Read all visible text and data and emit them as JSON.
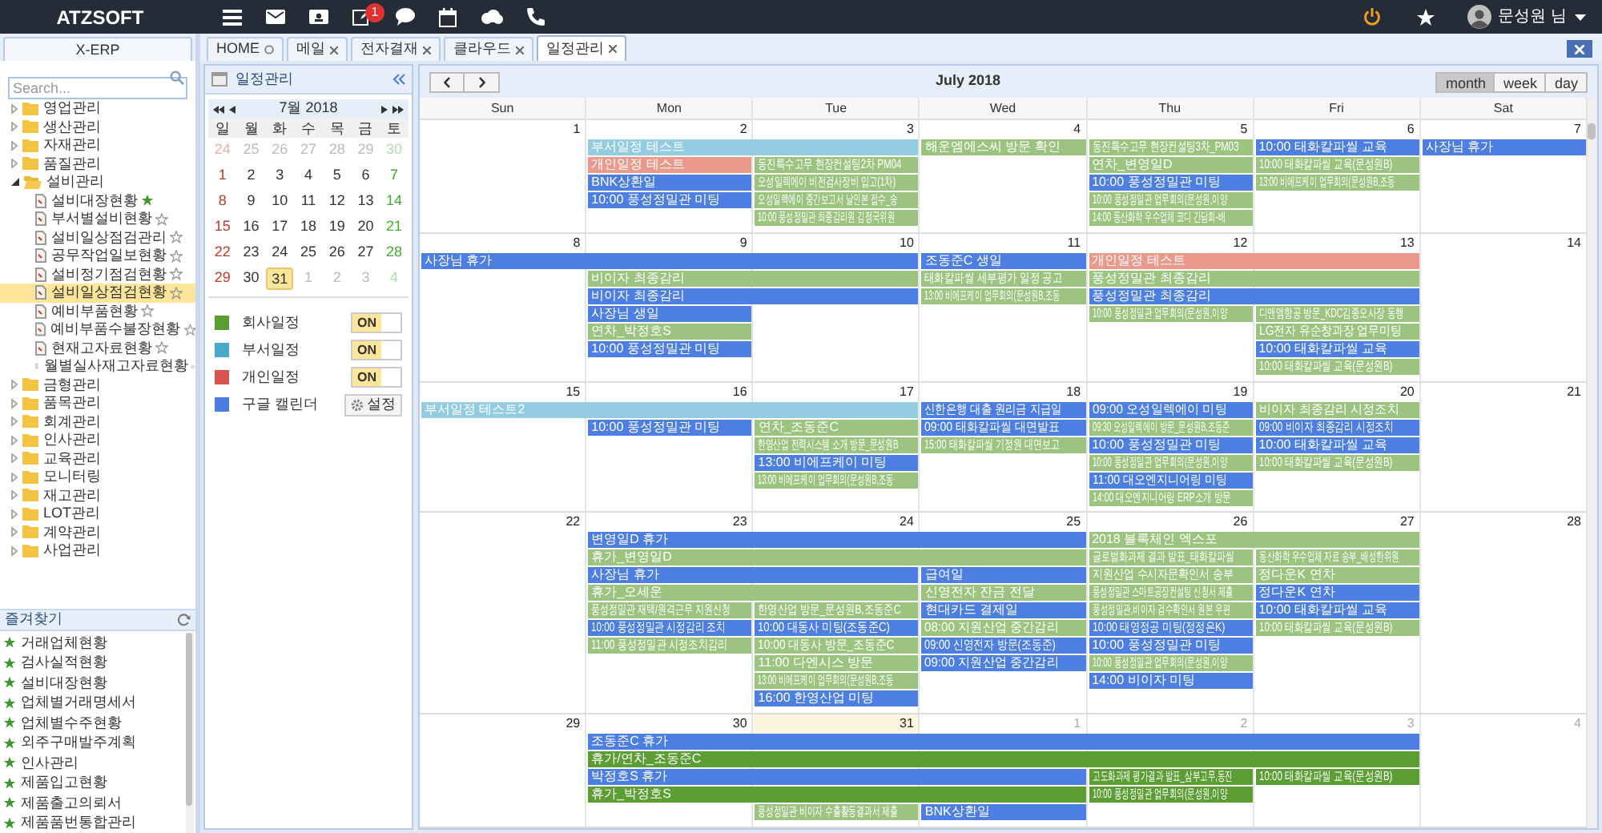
{
  "topbar": {
    "logo": "ATZSOFT",
    "badge": "1",
    "user": "문성원 님"
  },
  "sidebar": {
    "tab": "X-ERP",
    "search": {
      "placeholder": "Search..."
    },
    "tree": [
      {
        "label": "영업관리",
        "kind": "folder",
        "expanded": false,
        "selected": false
      },
      {
        "label": "생산관리",
        "kind": "folder",
        "expanded": false,
        "selected": false
      },
      {
        "label": "자재관리",
        "kind": "folder",
        "expanded": false,
        "selected": false
      },
      {
        "label": "품질관리",
        "kind": "folder",
        "expanded": false,
        "selected": false
      },
      {
        "label": "설비관리",
        "kind": "folder",
        "expanded": true,
        "selected": false,
        "children": [
          {
            "label": "설비대장현황",
            "kind": "page",
            "starred": true,
            "selected": false
          },
          {
            "label": "부서별설비현황",
            "kind": "page",
            "starred": false,
            "selected": false
          },
          {
            "label": "설비일상점검관리",
            "kind": "page",
            "starred": false,
            "selected": false
          },
          {
            "label": "공무작업일보현황",
            "kind": "page",
            "starred": false,
            "selected": false
          },
          {
            "label": "설비정기점검현황",
            "kind": "page",
            "starred": false,
            "selected": false
          },
          {
            "label": "설비일상점검현황",
            "kind": "page",
            "starred": false,
            "selected": true
          },
          {
            "label": "예비부품현황",
            "kind": "page",
            "starred": false,
            "selected": false
          },
          {
            "label": "예비부품수불장현황",
            "kind": "page",
            "starred": false,
            "selected": false
          },
          {
            "label": "현재고자료현황",
            "kind": "page",
            "starred": false,
            "selected": false
          },
          {
            "label": "월별실사재고자료현황",
            "kind": "page",
            "starred": false,
            "selected": false
          }
        ]
      },
      {
        "label": "금형관리",
        "kind": "folder",
        "expanded": false,
        "selected": false
      },
      {
        "label": "품목관리",
        "kind": "folder",
        "expanded": false,
        "selected": false
      },
      {
        "label": "회계관리",
        "kind": "folder",
        "expanded": false,
        "selected": false
      },
      {
        "label": "인사관리",
        "kind": "folder",
        "expanded": false,
        "selected": false
      },
      {
        "label": "교육관리",
        "kind": "folder",
        "expanded": false,
        "selected": false
      },
      {
        "label": "모니터링",
        "kind": "folder",
        "expanded": false,
        "selected": false
      },
      {
        "label": "재고관리",
        "kind": "folder",
        "expanded": false,
        "selected": false
      },
      {
        "label": "LOT관리",
        "kind": "folder",
        "expanded": false,
        "selected": false
      },
      {
        "label": "계약관리",
        "kind": "folder",
        "expanded": false,
        "selected": false
      },
      {
        "label": "사업관리",
        "kind": "folder",
        "expanded": false,
        "selected": false
      }
    ],
    "favorites_title": "즐겨찾기",
    "favorites": [
      "거래업체현황",
      "검사실적현황",
      "설비대장현황",
      "업체별거래명세서",
      "업체별수주현황",
      "외주구매발주계획",
      "인사관리",
      "제품입고현황",
      "제품출고의뢰서",
      "제품품번통합관리"
    ]
  },
  "tabs": [
    {
      "label": "HOME",
      "kind": "home",
      "selected": false
    },
    {
      "label": "메일",
      "kind": "closable",
      "selected": false
    },
    {
      "label": "전자결재",
      "kind": "closable",
      "selected": false
    },
    {
      "label": "클라우드",
      "kind": "closable",
      "selected": false
    },
    {
      "label": "일정관리",
      "kind": "closable",
      "selected": true
    }
  ],
  "mini_calendar": {
    "title": "일정관리",
    "month": "7월 2018",
    "weekdays": [
      "일",
      "월",
      "화",
      "수",
      "목",
      "금",
      "토"
    ],
    "weeks": [
      [
        {
          "label": "24",
          "other_month": true,
          "selected": false
        },
        {
          "label": "25",
          "other_month": true,
          "selected": false
        },
        {
          "label": "26",
          "other_month": true,
          "selected": false
        },
        {
          "label": "27",
          "other_month": true,
          "selected": false
        },
        {
          "label": "28",
          "other_month": true,
          "selected": false
        },
        {
          "label": "29",
          "other_month": true,
          "selected": false
        },
        {
          "label": "30",
          "other_month": true,
          "selected": false
        }
      ],
      [
        {
          "label": "1",
          "other_month": false,
          "selected": false
        },
        {
          "label": "2",
          "other_month": false,
          "selected": false
        },
        {
          "label": "3",
          "other_month": false,
          "selected": false
        },
        {
          "label": "4",
          "other_month": false,
          "selected": false
        },
        {
          "label": "5",
          "other_month": false,
          "selected": false
        },
        {
          "label": "6",
          "other_month": false,
          "selected": false
        },
        {
          "label": "7",
          "other_month": false,
          "selected": false
        }
      ],
      [
        {
          "label": "8",
          "other_month": false,
          "selected": false
        },
        {
          "label": "9",
          "other_month": false,
          "selected": false
        },
        {
          "label": "10",
          "other_month": false,
          "selected": false
        },
        {
          "label": "11",
          "other_month": false,
          "selected": false
        },
        {
          "label": "12",
          "other_month": false,
          "selected": false
        },
        {
          "label": "13",
          "other_month": false,
          "selected": false
        },
        {
          "label": "14",
          "other_month": false,
          "selected": false
        }
      ],
      [
        {
          "label": "15",
          "other_month": false,
          "selected": false
        },
        {
          "label": "16",
          "other_month": false,
          "selected": false
        },
        {
          "label": "17",
          "other_month": false,
          "selected": false
        },
        {
          "label": "18",
          "other_month": false,
          "selected": false
        },
        {
          "label": "19",
          "other_month": false,
          "selected": false
        },
        {
          "label": "20",
          "other_month": false,
          "selected": false
        },
        {
          "label": "21",
          "other_month": false,
          "selected": false
        }
      ],
      [
        {
          "label": "22",
          "other_month": false,
          "selected": false
        },
        {
          "label": "23",
          "other_month": false,
          "selected": false
        },
        {
          "label": "24",
          "other_month": false,
          "selected": false
        },
        {
          "label": "25",
          "other_month": false,
          "selected": false
        },
        {
          "label": "26",
          "other_month": false,
          "selected": false
        },
        {
          "label": "27",
          "other_month": false,
          "selected": false
        },
        {
          "label": "28",
          "other_month": false,
          "selected": false
        }
      ],
      [
        {
          "label": "29",
          "other_month": false,
          "selected": false
        },
        {
          "label": "30",
          "other_month": false,
          "selected": false
        },
        {
          "label": "31",
          "other_month": false,
          "selected": true
        },
        {
          "label": "1",
          "other_month": true,
          "selected": false
        },
        {
          "label": "2",
          "other_month": true,
          "selected": false
        },
        {
          "label": "3",
          "other_month": true,
          "selected": false
        },
        {
          "label": "4",
          "other_month": true,
          "selected": false
        }
      ]
    ]
  },
  "calendars": [
    {
      "label": "회사일정",
      "color": "#5a9e32",
      "kind": "toggle",
      "on": true,
      "toggle_label": "ON"
    },
    {
      "label": "부서일정",
      "color": "#48a9c8",
      "kind": "toggle",
      "on": true,
      "toggle_label": "ON"
    },
    {
      "label": "개인일정",
      "color": "#d9534f",
      "kind": "toggle",
      "on": true,
      "toggle_label": "ON"
    },
    {
      "label": "구글 캘린더",
      "color": "#4a7ee0",
      "kind": "button",
      "button_label": "설정"
    }
  ],
  "calendar": {
    "title": "July 2018",
    "views": [
      {
        "label": "month",
        "selected": true
      },
      {
        "label": "week",
        "selected": false
      },
      {
        "label": "day",
        "selected": false
      }
    ],
    "weekdays": [
      "Sun",
      "Mon",
      "Tue",
      "Wed",
      "Thu",
      "Fri",
      "Sat"
    ],
    "weeks": [
      {
        "days": [
          {
            "label": "1",
            "other_month": false,
            "today": false
          },
          {
            "label": "2",
            "other_month": false,
            "today": false
          },
          {
            "label": "3",
            "other_month": false,
            "today": false
          },
          {
            "label": "4",
            "other_month": false,
            "today": false
          },
          {
            "label": "5",
            "other_month": false,
            "today": false
          },
          {
            "label": "6",
            "other_month": false,
            "today": false
          },
          {
            "label": "7",
            "other_month": false,
            "today": false
          }
        ],
        "lanes": [
          [
            {
              "kind": "none"
            },
            {
              "kind": "event",
              "text": "부서일정 테스트",
              "color": "#93cce0"
            },
            {
              "kind": "continued"
            },
            {
              "kind": "event",
              "text": "해운엠에스씨 방문 확인",
              "color": "#9cc480"
            },
            {
              "kind": "event",
              "text": "동진특수고무 현장컨설팅3차_PM03",
              "color": "#9cc480"
            },
            {
              "kind": "event",
              "text": "10:00 태화칼파씰 교육",
              "color": "#4d7fe3"
            },
            {
              "kind": "event",
              "text": "사장님 휴가",
              "color": "#4d7fe3"
            }
          ],
          [
            {
              "kind": "none"
            },
            {
              "kind": "event",
              "text": "개인일정 테스트",
              "color": "#e99a8d"
            },
            {
              "kind": "event",
              "text": "동진특수고무 현장컨설팅2차 PM04",
              "color": "#9cc480"
            },
            {
              "kind": "none"
            },
            {
              "kind": "event",
              "text": "연차_변영일D",
              "color": "#9cc480"
            },
            {
              "kind": "event",
              "text": "10:00 태화칼파씰 교육(문성원B)",
              "color": "#9cc480"
            },
            {
              "kind": "none"
            }
          ],
          [
            {
              "kind": "none"
            },
            {
              "kind": "event",
              "text": "BNK상환일",
              "color": "#4d7fe3"
            },
            {
              "kind": "event",
              "text": "오성일렉에이 비전검사장비 입고(1차)",
              "color": "#9cc480"
            },
            {
              "kind": "none"
            },
            {
              "kind": "event",
              "text": "10:00 풍성정밀관 미팅",
              "color": "#4d7fe3"
            },
            {
              "kind": "event",
              "text": "13:00 비에프케이 업무회의(문성원B,조동",
              "color": "#9cc480"
            },
            {
              "kind": "none"
            }
          ],
          [
            {
              "kind": "none"
            },
            {
              "kind": "event",
              "text": "10:00 풍성정밀관 미팅",
              "color": "#4d7fe3"
            },
            {
              "kind": "event",
              "text": "오성일렉에이 중간보고서 날인본 접수_송",
              "color": "#9cc480"
            },
            {
              "kind": "none"
            },
            {
              "kind": "event",
              "text": "10:00 풍성정밀관 업무회의(문성원,이양",
              "color": "#9cc480"
            },
            {
              "kind": "none"
            },
            {
              "kind": "none"
            }
          ],
          [
            {
              "kind": "none"
            },
            {
              "kind": "none"
            },
            {
              "kind": "event",
              "text": "10:00 풍성정밀관 최종감리원 김정국위원",
              "color": "#9cc480"
            },
            {
              "kind": "none"
            },
            {
              "kind": "event",
              "text": "14:00 동산화학 우수업체 코디 간담회-배",
              "color": "#9cc480"
            },
            {
              "kind": "none"
            },
            {
              "kind": "none"
            }
          ]
        ]
      },
      {
        "days": [
          {
            "label": "8",
            "other_month": false,
            "today": false
          },
          {
            "label": "9",
            "other_month": false,
            "today": false
          },
          {
            "label": "10",
            "other_month": false,
            "today": false
          },
          {
            "label": "11",
            "other_month": false,
            "today": false
          },
          {
            "label": "12",
            "other_month": false,
            "today": false
          },
          {
            "label": "13",
            "other_month": false,
            "today": false
          },
          {
            "label": "14",
            "other_month": false,
            "today": false
          }
        ],
        "lanes": [
          [
            {
              "kind": "event",
              "text": "사장님 휴가",
              "color": "#4d7fe3"
            },
            {
              "kind": "continued"
            },
            {
              "kind": "continued"
            },
            {
              "kind": "event",
              "text": "조동준C 생일",
              "color": "#4d7fe3"
            },
            {
              "kind": "event",
              "text": "개인일정 테스트",
              "color": "#e99a8d"
            },
            {
              "kind": "continued"
            },
            {
              "kind": "none"
            }
          ],
          [
            {
              "kind": "none"
            },
            {
              "kind": "event",
              "text": "비이자 최종감리",
              "color": "#9cc480"
            },
            {
              "kind": "continued"
            },
            {
              "kind": "event",
              "text": "태화칼파씰 세부평가 일정 공고",
              "color": "#9cc480"
            },
            {
              "kind": "event",
              "text": "풍성정밀관 최종감리",
              "color": "#9cc480"
            },
            {
              "kind": "continued"
            },
            {
              "kind": "none"
            }
          ],
          [
            {
              "kind": "none"
            },
            {
              "kind": "event",
              "text": "비이자 최종감리",
              "color": "#4d7fe3"
            },
            {
              "kind": "continued"
            },
            {
              "kind": "event",
              "text": "13:00 비에프케이 업무회의(문성원B,조동",
              "color": "#9cc480"
            },
            {
              "kind": "event",
              "text": "풍성정밀관 최종감리",
              "color": "#4d7fe3"
            },
            {
              "kind": "continued"
            },
            {
              "kind": "none"
            }
          ],
          [
            {
              "kind": "none"
            },
            {
              "kind": "event",
              "text": "사장님 생일",
              "color": "#4d7fe3"
            },
            {
              "kind": "none"
            },
            {
              "kind": "none"
            },
            {
              "kind": "event",
              "text": "10:00 풍성정밀관 업무회의(문성원,이양",
              "color": "#9cc480"
            },
            {
              "kind": "event",
              "text": "디앤엠항공 방문_KDC김종오사장 동행",
              "color": "#9cc480"
            },
            {
              "kind": "none"
            }
          ],
          [
            {
              "kind": "none"
            },
            {
              "kind": "event",
              "text": "연차_박정호S",
              "color": "#9cc480"
            },
            {
              "kind": "none"
            },
            {
              "kind": "none"
            },
            {
              "kind": "none"
            },
            {
              "kind": "event",
              "text": "LG전자 유순창과장 업무미팅",
              "color": "#9cc480"
            },
            {
              "kind": "none"
            }
          ],
          [
            {
              "kind": "none"
            },
            {
              "kind": "event",
              "text": "10:00 풍성정밀관 미팅",
              "color": "#4d7fe3"
            },
            {
              "kind": "none"
            },
            {
              "kind": "none"
            },
            {
              "kind": "none"
            },
            {
              "kind": "event",
              "text": "10:00 태화칼파씰 교육",
              "color": "#4d7fe3"
            },
            {
              "kind": "none"
            }
          ],
          [
            {
              "kind": "none"
            },
            {
              "kind": "none"
            },
            {
              "kind": "none"
            },
            {
              "kind": "none"
            },
            {
              "kind": "none"
            },
            {
              "kind": "event",
              "text": "10:00 태화칼파씰 교육(문성원B)",
              "color": "#9cc480"
            },
            {
              "kind": "none"
            }
          ]
        ]
      },
      {
        "days": [
          {
            "label": "15",
            "other_month": false,
            "today": false
          },
          {
            "label": "16",
            "other_month": false,
            "today": false
          },
          {
            "label": "17",
            "other_month": false,
            "today": false
          },
          {
            "label": "18",
            "other_month": false,
            "today": false
          },
          {
            "label": "19",
            "other_month": false,
            "today": false
          },
          {
            "label": "20",
            "other_month": false,
            "today": false
          },
          {
            "label": "21",
            "other_month": false,
            "today": false
          }
        ],
        "lanes": [
          [
            {
              "kind": "event",
              "text": "부서일정 테스트2",
              "color": "#93cce0"
            },
            {
              "kind": "continued"
            },
            {
              "kind": "continued"
            },
            {
              "kind": "event",
              "text": "신한은행 대출 원리금 지급일",
              "color": "#4d7fe3"
            },
            {
              "kind": "event",
              "text": "09:00 오성일렉에이 미팅",
              "color": "#4d7fe3"
            },
            {
              "kind": "event",
              "text": "비이자 최종감리 시정조치",
              "color": "#9cc480"
            },
            {
              "kind": "none"
            }
          ],
          [
            {
              "kind": "none"
            },
            {
              "kind": "event",
              "text": "10:00 풍성정밀관 미팅",
              "color": "#4d7fe3"
            },
            {
              "kind": "event",
              "text": "연차_조동준C",
              "color": "#9cc480"
            },
            {
              "kind": "event",
              "text": "09:00 태화칼파씰 대면발표",
              "color": "#4d7fe3"
            },
            {
              "kind": "event",
              "text": "09:30 오성일렉에이 방문_문성원B,조동준",
              "color": "#9cc480"
            },
            {
              "kind": "event",
              "text": "09:00 비이자 최종감리 시정조치",
              "color": "#4d7fe3"
            },
            {
              "kind": "none"
            }
          ],
          [
            {
              "kind": "none"
            },
            {
              "kind": "none"
            },
            {
              "kind": "event",
              "text": "한영산업 전력시스템 소개 방문_문성원B",
              "color": "#9cc480"
            },
            {
              "kind": "event",
              "text": "15:00 태화칼파씰 기정원 대면보고",
              "color": "#9cc480"
            },
            {
              "kind": "event",
              "text": "10:00 풍성정밀관 미팅",
              "color": "#4d7fe3"
            },
            {
              "kind": "event",
              "text": "10:00 태화칼파씰 교육",
              "color": "#4d7fe3"
            },
            {
              "kind": "none"
            }
          ],
          [
            {
              "kind": "none"
            },
            {
              "kind": "none"
            },
            {
              "kind": "event",
              "text": "13:00 비에프케이 미팅",
              "color": "#4d7fe3"
            },
            {
              "kind": "none"
            },
            {
              "kind": "event",
              "text": "10:00 풍성정밀관 업무회의(문성원,이양",
              "color": "#9cc480"
            },
            {
              "kind": "event",
              "text": "10:00 태화칼파씰 교육(문성원B)",
              "color": "#9cc480"
            },
            {
              "kind": "none"
            }
          ],
          [
            {
              "kind": "none"
            },
            {
              "kind": "none"
            },
            {
              "kind": "event",
              "text": "13:00 비에프케이 업무회의(문성원B,조동",
              "color": "#9cc480"
            },
            {
              "kind": "none"
            },
            {
              "kind": "event",
              "text": "11:00 대오엔지니어링 미팅",
              "color": "#4d7fe3"
            },
            {
              "kind": "none"
            },
            {
              "kind": "none"
            }
          ],
          [
            {
              "kind": "none"
            },
            {
              "kind": "none"
            },
            {
              "kind": "none"
            },
            {
              "kind": "none"
            },
            {
              "kind": "event",
              "text": "14:00 대오엔지니어링 ERP소개 방문",
              "color": "#9cc480"
            },
            {
              "kind": "none"
            },
            {
              "kind": "none"
            }
          ]
        ]
      },
      {
        "days": [
          {
            "label": "22",
            "other_month": false,
            "today": false
          },
          {
            "label": "23",
            "other_month": false,
            "today": false
          },
          {
            "label": "24",
            "other_month": false,
            "today": false
          },
          {
            "label": "25",
            "other_month": false,
            "today": false
          },
          {
            "label": "26",
            "other_month": false,
            "today": false
          },
          {
            "label": "27",
            "other_month": false,
            "today": false
          },
          {
            "label": "28",
            "other_month": false,
            "today": false
          }
        ],
        "lanes": [
          [
            {
              "kind": "none"
            },
            {
              "kind": "event",
              "text": "변영일D 휴가",
              "color": "#4d7fe3"
            },
            {
              "kind": "continued"
            },
            {
              "kind": "continued"
            },
            {
              "kind": "event",
              "text": "2018 블록체인 엑스포",
              "color": "#9cc480"
            },
            {
              "kind": "continued"
            },
            {
              "kind": "none"
            }
          ],
          [
            {
              "kind": "none"
            },
            {
              "kind": "event",
              "text": "휴가_변영일D",
              "color": "#9cc480"
            },
            {
              "kind": "continued"
            },
            {
              "kind": "continued"
            },
            {
              "kind": "event",
              "text": "글로벌화과제 결과 발표_태화칼파씰",
              "color": "#9cc480"
            },
            {
              "kind": "event",
              "text": "동산화학 우수업체 자료 송부_배성한위원",
              "color": "#9cc480"
            },
            {
              "kind": "none"
            }
          ],
          [
            {
              "kind": "none"
            },
            {
              "kind": "event",
              "text": "사장님 휴가",
              "color": "#4d7fe3"
            },
            {
              "kind": "continued"
            },
            {
              "kind": "event",
              "text": "급여일",
              "color": "#4d7fe3"
            },
            {
              "kind": "event",
              "text": "지원산업 수시자문확인서 송부",
              "color": "#9cc480"
            },
            {
              "kind": "event",
              "text": "정다운K 연차",
              "color": "#9cc480"
            },
            {
              "kind": "none"
            }
          ],
          [
            {
              "kind": "none"
            },
            {
              "kind": "event",
              "text": "휴가_오세운",
              "color": "#9cc480"
            },
            {
              "kind": "continued"
            },
            {
              "kind": "event",
              "text": "신영전자 잔금 전달",
              "color": "#9cc480"
            },
            {
              "kind": "event",
              "text": "풍성정밀관 스마트공장컨설팅 신청서 제출",
              "color": "#9cc480"
            },
            {
              "kind": "event",
              "text": "정다운K 연차",
              "color": "#4d7fe3"
            },
            {
              "kind": "none"
            }
          ],
          [
            {
              "kind": "none"
            },
            {
              "kind": "event",
              "text": "풍성정밀관 재택/원격근무 지원신청",
              "color": "#9cc480"
            },
            {
              "kind": "event",
              "text": "한영산업 방문_문성원B,조동준C",
              "color": "#9cc480"
            },
            {
              "kind": "event",
              "text": "현대카드 결제일",
              "color": "#4d7fe3"
            },
            {
              "kind": "event",
              "text": "풍성정밀관,비이자 검수확인서 원본 우편",
              "color": "#9cc480"
            },
            {
              "kind": "event",
              "text": "10:00 태화칼파씰 교육",
              "color": "#4d7fe3"
            },
            {
              "kind": "none"
            }
          ],
          [
            {
              "kind": "none"
            },
            {
              "kind": "event",
              "text": "10:00 풍성정밀관 시정감리 조치",
              "color": "#4d7fe3"
            },
            {
              "kind": "event",
              "text": "10:00 대동사 미팅(조동준C)",
              "color": "#4d7fe3"
            },
            {
              "kind": "event",
              "text": "08:00 지원산업 중간감리",
              "color": "#9cc480"
            },
            {
              "kind": "event",
              "text": "10:00 태영정공 미팅(정정은K)",
              "color": "#4d7fe3"
            },
            {
              "kind": "event",
              "text": "10:00 태화칼파씰 교육(문성원B)",
              "color": "#9cc480"
            },
            {
              "kind": "none"
            }
          ],
          [
            {
              "kind": "none"
            },
            {
              "kind": "event",
              "text": "11:00 풍성정밀관 시정조치감리",
              "color": "#9cc480"
            },
            {
              "kind": "event",
              "text": "10:00 대동사 방문_조동준C",
              "color": "#9cc480"
            },
            {
              "kind": "event",
              "text": "09:00 신영전자 방문(조동준)",
              "color": "#4d7fe3"
            },
            {
              "kind": "event",
              "text": "10:00 풍성정밀관 미팅",
              "color": "#4d7fe3"
            },
            {
              "kind": "none"
            },
            {
              "kind": "none"
            }
          ],
          [
            {
              "kind": "none"
            },
            {
              "kind": "none"
            },
            {
              "kind": "event",
              "text": "11:00 다엔시스 방문",
              "color": "#9cc480"
            },
            {
              "kind": "event",
              "text": "09:00 지원산업 중간감리",
              "color": "#4d7fe3"
            },
            {
              "kind": "event",
              "text": "10:00 풍성정밀관 업무회의(문성원,이양",
              "color": "#9cc480"
            },
            {
              "kind": "none"
            },
            {
              "kind": "none"
            }
          ],
          [
            {
              "kind": "none"
            },
            {
              "kind": "none"
            },
            {
              "kind": "event",
              "text": "13:00 비에프케이 업무회의(문성원B,조동",
              "color": "#9cc480"
            },
            {
              "kind": "none"
            },
            {
              "kind": "event",
              "text": "14:00 비이자 미팅",
              "color": "#4d7fe3"
            },
            {
              "kind": "none"
            },
            {
              "kind": "none"
            }
          ],
          [
            {
              "kind": "none"
            },
            {
              "kind": "none"
            },
            {
              "kind": "event",
              "text": "16:00 한영산업 미팅",
              "color": "#4d7fe3"
            },
            {
              "kind": "none"
            },
            {
              "kind": "none"
            },
            {
              "kind": "none"
            },
            {
              "kind": "none"
            }
          ]
        ]
      },
      {
        "days": [
          {
            "label": "29",
            "other_month": false,
            "today": false
          },
          {
            "label": "30",
            "other_month": false,
            "today": false
          },
          {
            "label": "31",
            "other_month": false,
            "today": true
          },
          {
            "label": "1",
            "other_month": true,
            "today": false
          },
          {
            "label": "2",
            "other_month": true,
            "today": false
          },
          {
            "label": "3",
            "other_month": true,
            "today": false
          },
          {
            "label": "4",
            "other_month": true,
            "today": false
          }
        ],
        "lanes": [
          [
            {
              "kind": "none"
            },
            {
              "kind": "event",
              "text": "조동준C 휴가",
              "color": "#4d7fe3"
            },
            {
              "kind": "continued"
            },
            {
              "kind": "continued"
            },
            {
              "kind": "continued"
            },
            {
              "kind": "continued"
            },
            {
              "kind": "none"
            }
          ],
          [
            {
              "kind": "none"
            },
            {
              "kind": "event",
              "text": "휴가/연차_조동준C",
              "color": "#5c9e34"
            },
            {
              "kind": "continued"
            },
            {
              "kind": "continued"
            },
            {
              "kind": "continued"
            },
            {
              "kind": "continued"
            },
            {
              "kind": "none"
            }
          ],
          [
            {
              "kind": "none"
            },
            {
              "kind": "event",
              "text": "박정호S 휴가",
              "color": "#4d7fe3"
            },
            {
              "kind": "continued"
            },
            {
              "kind": "continued"
            },
            {
              "kind": "event",
              "text": "고도화과제 평가결과 발표_삼부고무,동진",
              "color": "#5c9e34"
            },
            {
              "kind": "event",
              "text": "10:00 태화칼파씰 교육(문성원B)",
              "color": "#5c9e34"
            },
            {
              "kind": "none"
            }
          ],
          [
            {
              "kind": "none"
            },
            {
              "kind": "event",
              "text": "휴가_박정호S",
              "color": "#5c9e34"
            },
            {
              "kind": "continued"
            },
            {
              "kind": "continued"
            },
            {
              "kind": "event",
              "text": "10:00 풍성정밀관 업무회의(문성원,이양",
              "color": "#5c9e34"
            },
            {
              "kind": "none"
            },
            {
              "kind": "none"
            }
          ],
          [
            {
              "kind": "none"
            },
            {
              "kind": "none"
            },
            {
              "kind": "event",
              "text": "풍성정밀관 비이자 수출활동결과서 제출",
              "color": "#9cc480"
            },
            {
              "kind": "event",
              "text": "BNK상환일",
              "color": "#4d7fe3"
            },
            {
              "kind": "none"
            },
            {
              "kind": "none"
            },
            {
              "kind": "none"
            }
          ]
        ]
      }
    ]
  }
}
